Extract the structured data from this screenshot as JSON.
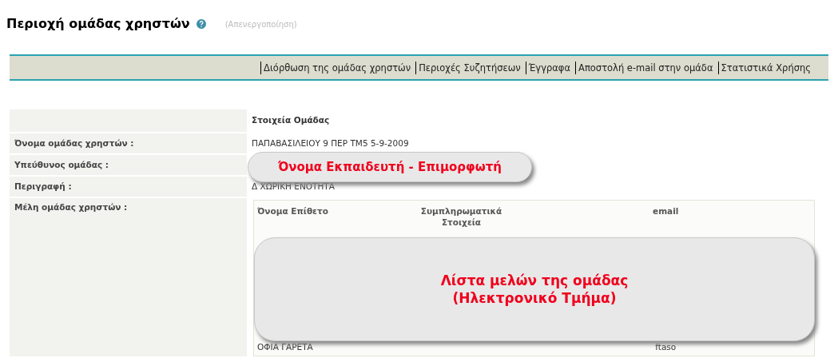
{
  "page_title": "Περιοχή ομάδας χρηστών",
  "status_link": "(Απενεργοποίηση)",
  "nav_links": [
    "Διόρθωση της ομάδας χρηστών",
    "Περιοχές Συζητήσεων",
    "Έγγραφα",
    "Αποστολή e-mail στην ομάδα",
    "Στατιστικά Χρήσης"
  ],
  "section_heading": "Στοιχεία Ομάδας",
  "fields": [
    {
      "label": "Όνομα ομάδας χρηστών :",
      "value": "ΠΑΠΑΒΑΣΙΛΕΙΟΥ 9 ΠΕΡ ΤΜ5 5-9-2009"
    },
    {
      "label": "Υπεύθυνος ομάδας :"
    },
    {
      "label": "Περιγραφή :",
      "value": "Δ ΧΩΡΙΚΗ ΕΝΟΤΗΤΑ"
    }
  ],
  "members": {
    "label": "Μέλη ομάδας χρηστών :",
    "columns": [
      "Όνομα Επίθετο",
      "Συμπληρωματικά Στοιχεία",
      "email"
    ],
    "rows": [
      [
        "ΟΦΙΑ ΓΑΡΕΤΑ",
        "",
        "ftaso"
      ]
    ]
  },
  "callouts": [
    {
      "text": "Όνομα Εκπαιδευτή - Επιμορφωτή"
    },
    {
      "text": "Λίστα μελών της ομάδας\n(Ηλεκτρονικό Τμήμα)"
    }
  ]
}
